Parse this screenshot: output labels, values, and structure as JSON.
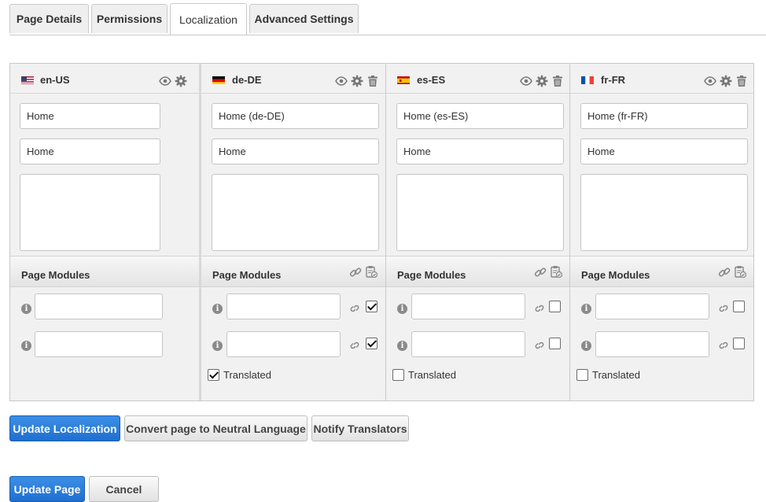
{
  "tabs": [
    {
      "label": "Page Details"
    },
    {
      "label": "Permissions"
    },
    {
      "label": "Localization"
    },
    {
      "label": "Advanced Settings"
    }
  ],
  "cultures": [
    {
      "code": "en-US",
      "flag": "us-flag-icon",
      "name_value": "Home",
      "title_value": "Home",
      "can_delete": false,
      "modules_heading": "Page Modules",
      "modules_header_icons": false,
      "modules": [
        {
          "unlink": false,
          "checked": null
        },
        {
          "unlink": false,
          "checked": null
        }
      ],
      "translated_label": "",
      "translated_checked": null
    },
    {
      "code": "de-DE",
      "flag": "de-flag-icon",
      "name_value": "Home (de-DE)",
      "title_value": "Home",
      "can_delete": true,
      "modules_heading": "Page Modules",
      "modules_header_icons": true,
      "modules": [
        {
          "unlink": true,
          "checked": true
        },
        {
          "unlink": true,
          "checked": true
        }
      ],
      "translated_label": "Translated",
      "translated_checked": true
    },
    {
      "code": "es-ES",
      "flag": "es-flag-icon",
      "name_value": "Home (es-ES)",
      "title_value": "Home",
      "can_delete": true,
      "modules_heading": "Page Modules",
      "modules_header_icons": true,
      "modules": [
        {
          "unlink": true,
          "checked": false
        },
        {
          "unlink": true,
          "checked": false
        }
      ],
      "translated_label": "Translated",
      "translated_checked": false
    },
    {
      "code": "fr-FR",
      "flag": "fr-flag-icon",
      "name_value": "Home (fr-FR)",
      "title_value": "Home",
      "can_delete": true,
      "modules_heading": "Page Modules",
      "modules_header_icons": true,
      "modules": [
        {
          "unlink": true,
          "checked": false
        },
        {
          "unlink": true,
          "checked": false
        }
      ],
      "translated_label": "Translated",
      "translated_checked": false
    }
  ],
  "actions": {
    "update_localization": "Update Localization",
    "convert_neutral": "Convert page to Neutral Language",
    "notify_translators": "Notify Translators"
  },
  "footer": {
    "update_page": "Update Page",
    "cancel": "Cancel"
  },
  "colors": {
    "primary_button": "#1f6fcf",
    "panel_background": "#f1f1f1"
  }
}
